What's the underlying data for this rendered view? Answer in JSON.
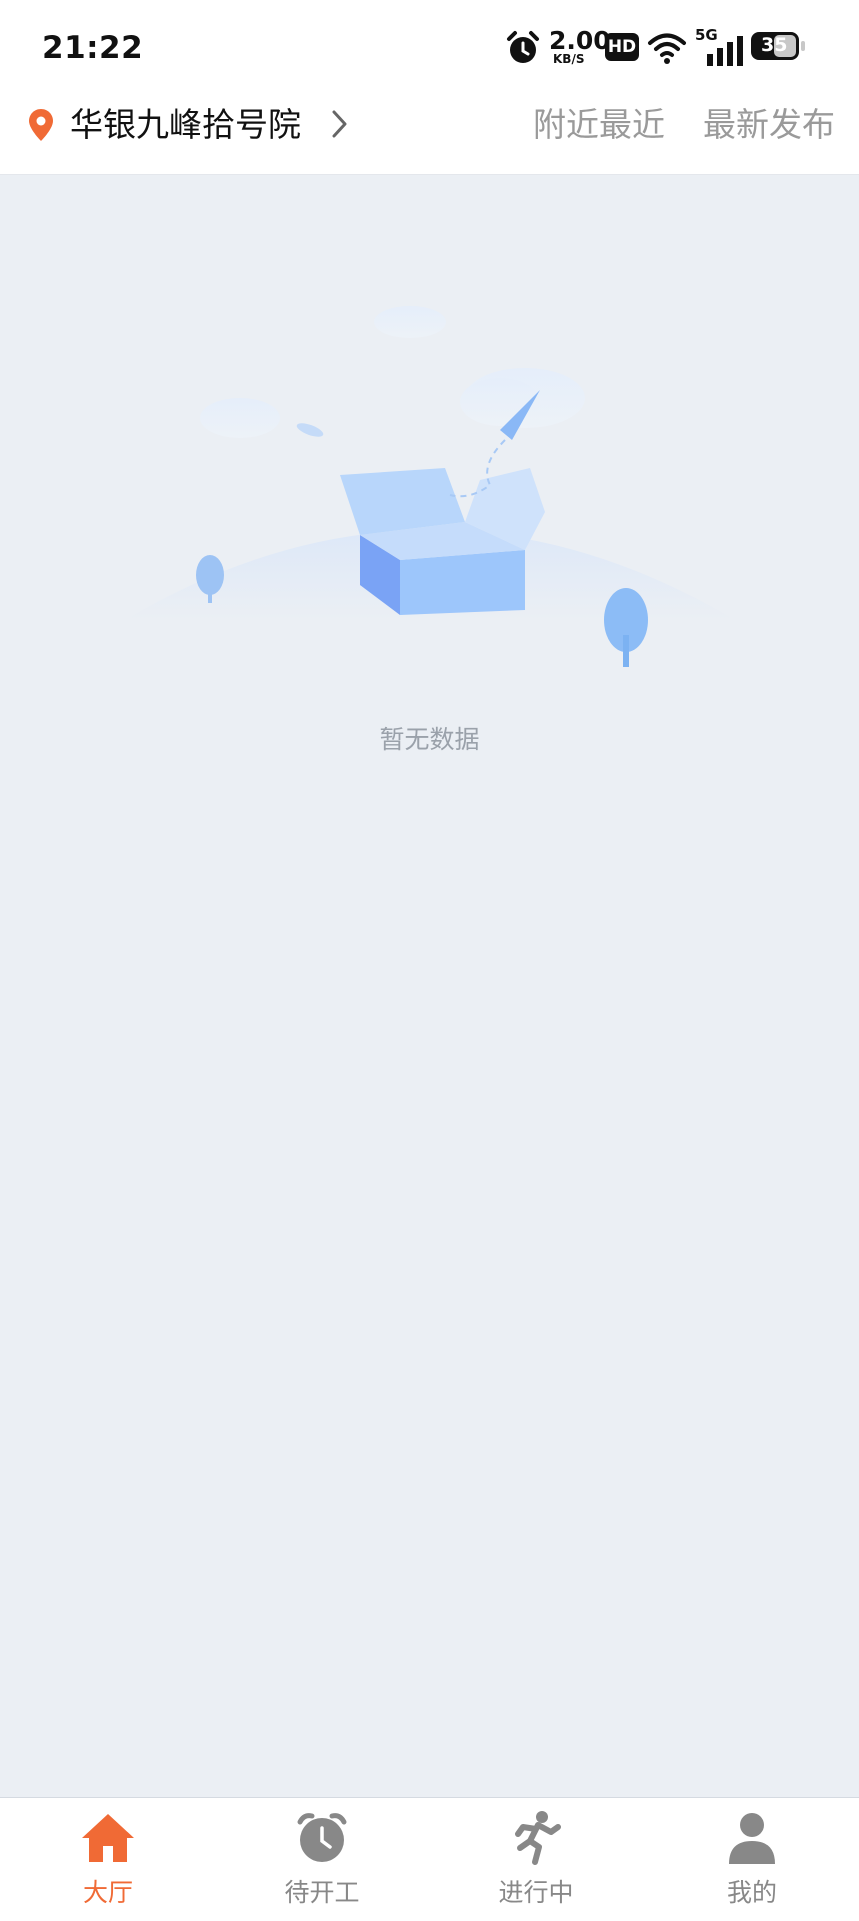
{
  "status_bar": {
    "time": "21:22",
    "net_rate": "2.00",
    "net_unit": "KB/S",
    "hd": "HD",
    "network": "5G",
    "battery": "35",
    "icons": [
      "alarm-icon",
      "hd-icon",
      "wifi-icon",
      "signal-icon",
      "battery-icon"
    ]
  },
  "header": {
    "location_icon": "location-pin-icon",
    "location_name": "华银九峰拾号院",
    "chevron_icon": "chevron-right-icon",
    "tabs": [
      {
        "label": "附近最近"
      },
      {
        "label": "最新发布"
      }
    ]
  },
  "empty_state": {
    "illustration": "empty-box-illustration",
    "message": "暂无数据"
  },
  "bottom_nav": {
    "items": [
      {
        "label": "大厅",
        "icon": "home-icon",
        "active": true
      },
      {
        "label": "待开工",
        "icon": "alarm-clock-icon",
        "active": false
      },
      {
        "label": "进行中",
        "icon": "running-icon",
        "active": false
      },
      {
        "label": "我的",
        "icon": "person-icon",
        "active": false
      }
    ]
  },
  "colors": {
    "accent": "#f06a35",
    "background": "#ebeff4",
    "inactive": "#888888"
  }
}
